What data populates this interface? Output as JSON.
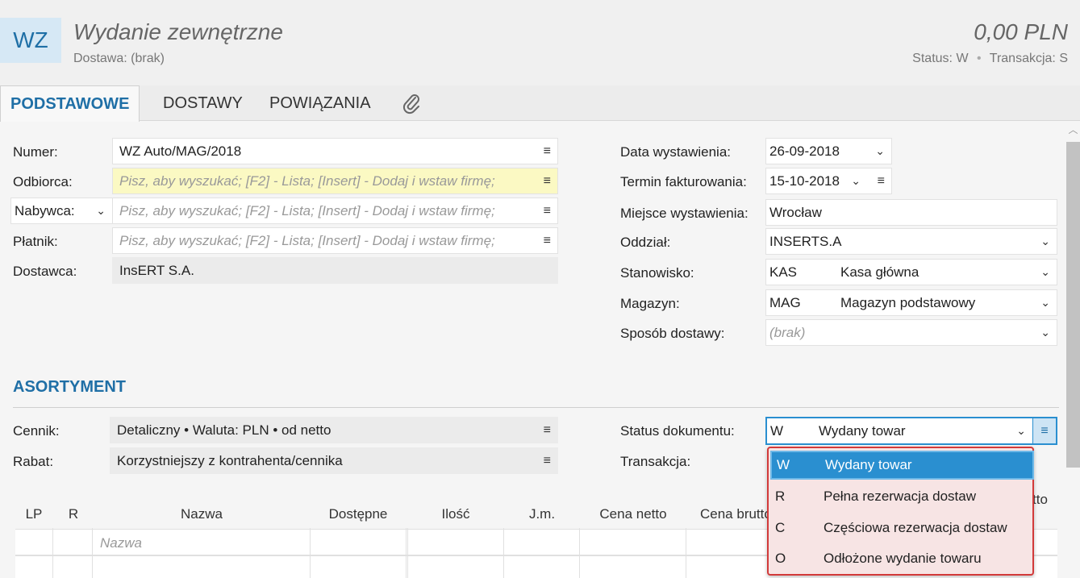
{
  "header": {
    "badge": "WZ",
    "title": "Wydanie zewnętrzne",
    "subtitle": "Dostawa: (brak)",
    "amount": "0,00 PLN",
    "status_label": "Status:",
    "status_value": "W",
    "separator": "•",
    "transaction_label": "Transakcja:",
    "transaction_value": "S"
  },
  "tabs": [
    "PODSTAWOWE",
    "DOSTAWY",
    "POWIĄZANIA"
  ],
  "left_form": {
    "numer_label": "Numer:",
    "numer_value": "WZ Auto/MAG/2018",
    "odbiorca_label": "Odbiorca:",
    "nabywca_label": "Nabywca:",
    "platnik_label": "Płatnik:",
    "search_placeholder": "Pisz, aby wyszukać; [F2] - Lista; [Insert] - Dodaj i wstaw firmę;",
    "dostawca_label": "Dostawca:",
    "dostawca_value": "InsERT S.A."
  },
  "right_form": {
    "data_label": "Data wystawienia:",
    "data_value": "26-09-2018",
    "termin_label": "Termin fakturowania:",
    "termin_value": "15-10-2018",
    "miejsce_label": "Miejsce wystawienia:",
    "miejsce_value": "Wrocław",
    "oddzial_label": "Oddział:",
    "oddzial_value": "INSERTS.A",
    "stanowisko_label": "Stanowisko:",
    "stanowisko_code": "KAS",
    "stanowisko_name": "Kasa główna",
    "magazyn_label": "Magazyn:",
    "magazyn_code": "MAG",
    "magazyn_name": "Magazyn podstawowy",
    "sposob_label": "Sposób dostawy:",
    "sposob_value": "(brak)"
  },
  "asortyment": {
    "title": "ASORTYMENT",
    "cennik_label": "Cennik:",
    "cennik_value": "Detaliczny • Waluta: PLN • od netto",
    "rabat_label": "Rabat:",
    "rabat_value": "Korzystniejszy z kontrahenta/cennika",
    "status_label": "Status dokumentu:",
    "status_code": "W",
    "status_value": "Wydany towar",
    "transakcja_label": "Transakcja:"
  },
  "table": {
    "columns": [
      "LP",
      "R",
      "Nazwa",
      "Dostępne",
      "Ilość",
      "J.m.",
      "Cena netto",
      "Cena brutto",
      "tto"
    ],
    "name_placeholder": "Nazwa"
  },
  "status_dropdown": {
    "options": [
      {
        "code": "W",
        "label": "Wydany towar"
      },
      {
        "code": "R",
        "label": "Pełna rezerwacja dostaw"
      },
      {
        "code": "C",
        "label": "Częściowa rezerwacja dostaw"
      },
      {
        "code": "O",
        "label": "Odłożone wydanie towaru"
      }
    ],
    "selected_index": 0
  },
  "icons": {
    "menu": "≡",
    "chevron": "⌄",
    "scroll_up": "︿"
  },
  "colors": {
    "accent": "#1f6fa6",
    "selection": "#2a8fd0",
    "highlight_field": "#fbf9c3",
    "dropdown_border": "#d23a3a"
  }
}
